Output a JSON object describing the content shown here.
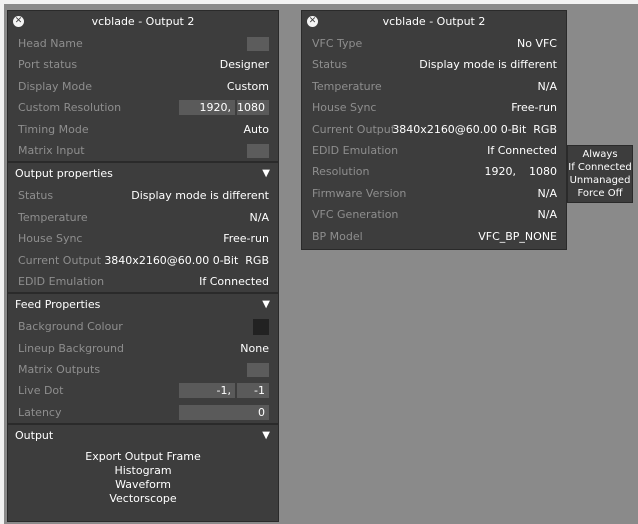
{
  "left_panel": {
    "title": "vcblade - Output 2",
    "rows": {
      "head_name": {
        "label": "Head Name"
      },
      "port_status": {
        "label": "Port status",
        "value": "Designer"
      },
      "display_mode": {
        "label": "Display Mode",
        "value": "Custom"
      },
      "custom_resolution": {
        "label": "Custom Resolution",
        "width": "1920,",
        "height": "1080"
      },
      "timing_mode": {
        "label": "Timing Mode",
        "value": "Auto"
      },
      "matrix_input": {
        "label": "Matrix Input"
      }
    },
    "output_properties": {
      "header": "Output properties",
      "status": {
        "label": "Status",
        "value": "Display mode is different"
      },
      "temperature": {
        "label": "Temperature",
        "value": "N/A"
      },
      "house_sync": {
        "label": "House Sync",
        "value": "Free-run"
      },
      "current_output": {
        "label": "Current Output",
        "value": "3840x2160@60.00 0-Bit  RGB"
      },
      "edid_emulation": {
        "label": "EDID Emulation",
        "value": "If Connected"
      }
    },
    "feed_properties": {
      "header": "Feed Properties",
      "background_colour": {
        "label": "Background Colour"
      },
      "lineup_background": {
        "label": "Lineup Background",
        "value": "None"
      },
      "matrix_outputs": {
        "label": "Matrix Outputs"
      },
      "live_dot": {
        "label": "Live Dot",
        "x": "-1,",
        "y": "-1"
      },
      "latency": {
        "label": "Latency",
        "value": "0"
      }
    },
    "output": {
      "header": "Output",
      "actions": [
        "Export Output Frame",
        "Histogram",
        "Waveform",
        "Vectorscope"
      ]
    }
  },
  "right_panel": {
    "title": "vcblade - Output 2",
    "vfc_type": {
      "label": "VFC Type",
      "value": "No VFC"
    },
    "status": {
      "label": "Status",
      "value": "Display mode is different"
    },
    "temperature": {
      "label": "Temperature",
      "value": "N/A"
    },
    "house_sync": {
      "label": "House Sync",
      "value": "Free-run"
    },
    "current_output": {
      "label": "Current Output",
      "value": "3840x2160@60.00 0-Bit  RGB"
    },
    "edid_emulation": {
      "label": "EDID Emulation",
      "value": "If Connected"
    },
    "resolution": {
      "label": "Resolution",
      "width": "1920,",
      "height": "1080"
    },
    "firmware_version": {
      "label": "Firmware Version",
      "value": "N/A"
    },
    "vfc_generation": {
      "label": "VFC Generation",
      "value": "N/A"
    },
    "bp_model": {
      "label": "BP Model",
      "value": "VFC_BP_NONE"
    }
  },
  "edid_dropdown": {
    "options": [
      "Always",
      "If Connected",
      "Unmanaged",
      "Force Off"
    ]
  },
  "icons": {
    "close": "close-icon",
    "collapse": "triangle-down-icon"
  }
}
